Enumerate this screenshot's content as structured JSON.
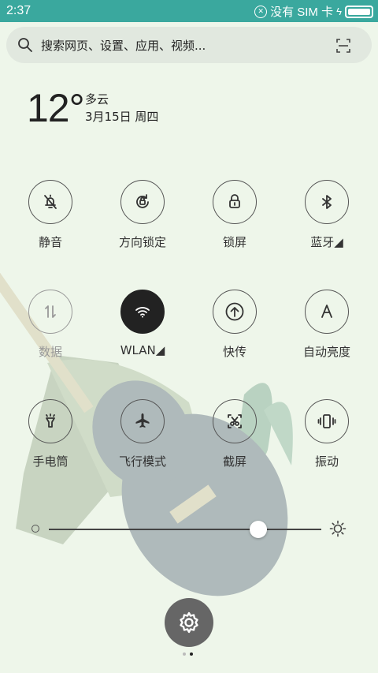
{
  "status_bar": {
    "time": "2:37",
    "network_text": "没有 SIM 卡",
    "battery_level": 1.0
  },
  "search": {
    "placeholder": "搜索网页、设置、应用、视频...",
    "left_icon": "search-icon",
    "right_icon": "scan-icon"
  },
  "weather": {
    "temperature": "12°",
    "condition": "多云",
    "date": "3月15日 周四"
  },
  "toggles": [
    {
      "label": "静音",
      "icon": "bell-off-icon",
      "state": "off"
    },
    {
      "label": "方向锁定",
      "icon": "rotation-lock-icon",
      "state": "off"
    },
    {
      "label": "锁屏",
      "icon": "lock-icon",
      "state": "off"
    },
    {
      "label": "蓝牙◢",
      "icon": "bluetooth-icon",
      "state": "off"
    },
    {
      "label": "数据",
      "icon": "data-arrows-icon",
      "state": "disabled"
    },
    {
      "label": "WLAN◢",
      "icon": "wifi-icon",
      "state": "on"
    },
    {
      "label": "快传",
      "icon": "transfer-icon",
      "state": "off"
    },
    {
      "label": "自动亮度",
      "icon": "auto-brightness-icon",
      "state": "off"
    },
    {
      "label": "手电筒",
      "icon": "flashlight-icon",
      "state": "off"
    },
    {
      "label": "飞行模式",
      "icon": "airplane-icon",
      "state": "off"
    },
    {
      "label": "截屏",
      "icon": "screenshot-icon",
      "state": "off"
    },
    {
      "label": "振动",
      "icon": "vibrate-icon",
      "state": "off"
    }
  ],
  "brightness": {
    "level": 0.77
  },
  "settings_button": {
    "icon": "gear-icon"
  },
  "page_indicator": {
    "total": 2,
    "current": 2
  },
  "colors": {
    "status_bar": "#3aa89e",
    "background": "#eef6ea",
    "active_toggle": "#222222"
  }
}
